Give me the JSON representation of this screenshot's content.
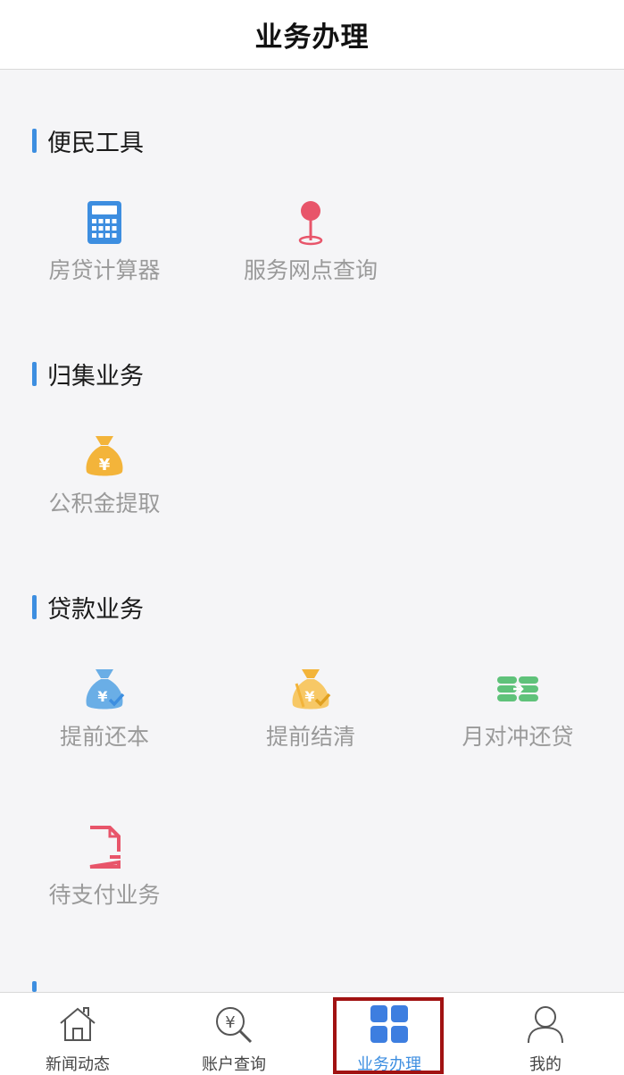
{
  "header": {
    "title": "业务办理"
  },
  "sections": [
    {
      "title": "便民工具",
      "items": [
        {
          "label": "房贷计算器",
          "icon": "calculator-icon"
        },
        {
          "label": "服务网点查询",
          "icon": "location-pin-icon"
        }
      ]
    },
    {
      "title": "归集业务",
      "items": [
        {
          "label": "公积金提取",
          "icon": "money-bag-icon"
        }
      ]
    },
    {
      "title": "贷款业务",
      "items": [
        {
          "label": "提前还本",
          "icon": "money-bag-check-icon"
        },
        {
          "label": "提前结清",
          "icon": "money-bag-settle-icon"
        },
        {
          "label": "月对冲还贷",
          "icon": "coin-stack-icon"
        },
        {
          "label": "待支付业务",
          "icon": "pending-document-icon"
        }
      ]
    }
  ],
  "tabbar": {
    "tabs": [
      {
        "label": "新闻动态",
        "icon": "home-icon"
      },
      {
        "label": "账户查询",
        "icon": "yen-search-icon"
      },
      {
        "label": "业务办理",
        "icon": "grid-icon",
        "active": true
      },
      {
        "label": "我的",
        "icon": "user-icon"
      }
    ]
  },
  "colors": {
    "accent": "#3d8ee0",
    "calculator": "#3d8ee0",
    "pin": "#e8556a",
    "gold": "#f3b43a",
    "green": "#5fc27a",
    "document": "#e8556a",
    "highlight": "#a11212"
  }
}
